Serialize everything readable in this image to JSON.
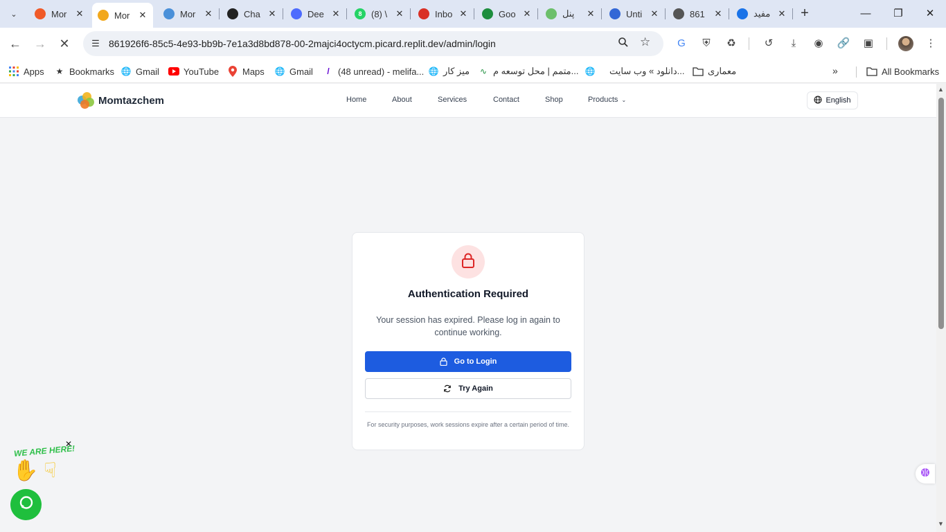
{
  "browser": {
    "tabs": [
      {
        "title": "Mor",
        "favicon_color": "#f05a28",
        "favicon": "orange-dots-icon"
      },
      {
        "title": "Mor",
        "favicon_color": "#f2a81d",
        "favicon": "momtazchem-icon",
        "active": true
      },
      {
        "title": "Mor",
        "favicon_color": "#4a90d9",
        "favicon": "momtazchem-icon"
      },
      {
        "title": "Cha",
        "favicon_color": "#222222",
        "favicon": "chatgpt-icon"
      },
      {
        "title": "Dee",
        "favicon_color": "#4d6bfe",
        "favicon": "deepseek-icon"
      },
      {
        "title": "(8) \\",
        "favicon_color": "#25d366",
        "favicon": "whatsapp-icon"
      },
      {
        "title": "Inbo",
        "favicon_color": "#d93025",
        "favicon": "mail-icon"
      },
      {
        "title": "Goo",
        "favicon_color": "#1e8e3e",
        "favicon": "google-icon"
      },
      {
        "title": "پنل",
        "favicon_color": "#6cbf6b",
        "favicon": "panel-icon"
      },
      {
        "title": "Unti",
        "favicon_color": "#3367d6",
        "favicon": "globe-icon"
      },
      {
        "title": "861",
        "favicon_color": "#555555",
        "favicon": "globe-icon"
      },
      {
        "title": "مفید",
        "favicon_color": "#1a73e8",
        "favicon": "app-icon"
      }
    ],
    "url": "861926f6-85c5-4e93-bb9b-7e1a3d8bd878-00-2majci4octycm.picard.replit.dev/admin/login",
    "bookmarks": [
      {
        "label": "Apps",
        "icon": "apps-grid-icon"
      },
      {
        "label": "Bookmarks",
        "icon": "star-icon"
      },
      {
        "label": "Gmail",
        "icon": "globe-icon"
      },
      {
        "label": "YouTube",
        "icon": "youtube-icon"
      },
      {
        "label": "Maps",
        "icon": "maps-icon"
      },
      {
        "label": "Gmail",
        "icon": "globe-icon"
      },
      {
        "label": "(48 unread) - melifa...",
        "icon": "yahoo-icon"
      },
      {
        "label": "میز کار",
        "icon": "globe-icon"
      },
      {
        "label": "متمم | محل توسعه م...",
        "icon": "motamem-icon"
      },
      {
        "label": "دانلود » وب سایت...",
        "icon": "globe-icon"
      },
      {
        "label": "معماری",
        "icon": "folder-icon"
      }
    ],
    "all_bookmarks": "All Bookmarks"
  },
  "site": {
    "brand": "Momtazchem",
    "nav": [
      "Home",
      "About",
      "Services",
      "Contact",
      "Shop",
      "Products"
    ],
    "language": "English"
  },
  "auth_card": {
    "title": "Authentication Required",
    "message": "Your session has expired. Please log in again to continue working.",
    "login_button": "Go to Login",
    "retry_button": "Try Again",
    "note": "For security purposes, work sessions expire after a certain period of time.",
    "accent_color": "#1d5ce0",
    "lock_color": "#dc2626"
  },
  "widgets": {
    "we_are_here": "WE ARE HERE!",
    "chat_color": "#1fbf3d"
  }
}
